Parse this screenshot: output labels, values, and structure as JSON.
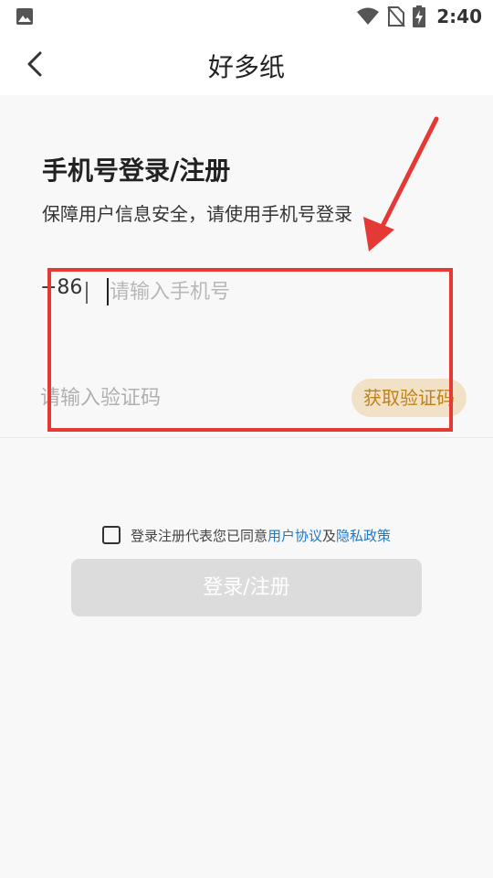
{
  "status_bar": {
    "time": "2:40",
    "icons": [
      "image-icon",
      "wifi-icon",
      "no-sim-icon",
      "battery-charging-icon"
    ]
  },
  "header": {
    "title": "好多纸",
    "back_icon": "chevron-left-icon"
  },
  "login": {
    "heading": "手机号登录/注册",
    "subheading": "保障用户信息安全，请使用手机号登录",
    "country_code": "+86",
    "phone_placeholder": "请输入手机号",
    "phone_value": "",
    "code_placeholder": "请输入验证码",
    "code_value": "",
    "get_code_label": "获取验证码"
  },
  "agreement": {
    "checked": false,
    "text": "登录注册代表您已同意",
    "link1": "用户协议",
    "conjunction": "及",
    "link2": "隐私政策"
  },
  "submit": {
    "label": "登录/注册"
  },
  "colors": {
    "accent_text": "#c0811a",
    "accent_bg": "#f1e1c6",
    "link": "#1e78c8",
    "annotation": "#e53935",
    "button_disabled": "#dcdcdc"
  }
}
